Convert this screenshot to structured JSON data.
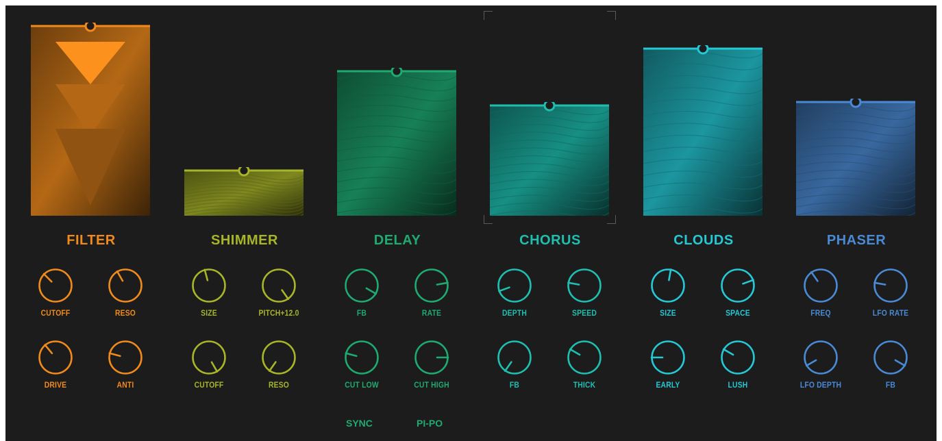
{
  "effects": [
    {
      "name": "FILTER",
      "color": "#f08a1c",
      "level": 1.0,
      "knobs": [
        {
          "label": "CUTOFF",
          "angle": -45
        },
        {
          "label": "RESO",
          "angle": -30
        },
        {
          "label": "DRIVE",
          "angle": -40
        },
        {
          "label": "ANTI",
          "angle": -75
        }
      ]
    },
    {
      "name": "SHIMMER",
      "color": "#a8b529",
      "level": 0.24,
      "knobs": [
        {
          "label": "SIZE",
          "angle": -15
        },
        {
          "label": "PITCH+12.0",
          "angle": 145
        },
        {
          "label": "CUTOFF",
          "angle": 150
        },
        {
          "label": "RESO",
          "angle": -145
        }
      ]
    },
    {
      "name": "DELAY",
      "color": "#1faa72",
      "level": 0.76,
      "knobs": [
        {
          "label": "FB",
          "angle": 120
        },
        {
          "label": "RATE",
          "angle": 80
        },
        {
          "label": "CUT LOW",
          "angle": -75
        },
        {
          "label": "CUT HIGH",
          "angle": 90
        }
      ]
    },
    {
      "name": "CHORUS",
      "color": "#1fbfb0",
      "level": 0.58,
      "knobs": [
        {
          "label": "DEPTH",
          "angle": -110
        },
        {
          "label": "SPEED",
          "angle": -80
        },
        {
          "label": "FB",
          "angle": -145
        },
        {
          "label": "THICK",
          "angle": -60
        }
      ]
    },
    {
      "name": "CLOUDS",
      "color": "#25c8d4",
      "level": 0.88,
      "knobs": [
        {
          "label": "SIZE",
          "angle": 10
        },
        {
          "label": "SPACE",
          "angle": 70
        },
        {
          "label": "EARLY",
          "angle": -90
        },
        {
          "label": "LUSH",
          "angle": -60
        }
      ]
    },
    {
      "name": "PHASER",
      "color": "#4a8ad4",
      "level": 0.6,
      "knobs": [
        {
          "label": "FREQ",
          "angle": -35
        },
        {
          "label": "LFO RATE",
          "angle": -80
        },
        {
          "label": "LFO DEPTH",
          "angle": -120
        },
        {
          "label": "FB",
          "angle": 120
        }
      ]
    }
  ],
  "extras": {
    "sync_label": "SYNC",
    "pipo_label": "PI-PO"
  },
  "colors": {
    "background": "#1c1c1c",
    "bracket": "#5a5a5a"
  }
}
